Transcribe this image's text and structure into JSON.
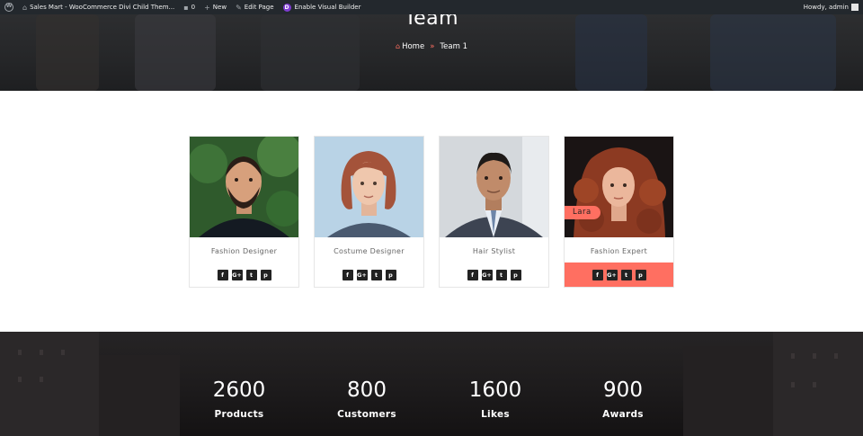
{
  "admin_bar": {
    "site_name": "Sales Mart - WooCommerce Divi Child Them...",
    "comments_count": "0",
    "new_label": "New",
    "edit_label": "Edit Page",
    "visual_builder_label": "Enable Visual Builder",
    "greeting": "Howdy, admin"
  },
  "hero": {
    "title": "Team",
    "breadcrumb_home": "Home",
    "breadcrumb_sep": "»",
    "breadcrumb_current": "Team 1"
  },
  "team": [
    {
      "role": "Fashion Designer",
      "name": "",
      "photo": "man-beard-photo"
    },
    {
      "role": "Costume Designer",
      "name": "",
      "photo": "woman-bob-photo"
    },
    {
      "role": "Hair Stylist",
      "name": "",
      "photo": "man-suit-photo"
    },
    {
      "role": "Fashion Expert",
      "name": "Lara",
      "photo": "woman-curly-photo"
    }
  ],
  "social_icons": [
    "f",
    "G+",
    "t",
    "p"
  ],
  "stats": [
    {
      "value": "2600",
      "label": "Products"
    },
    {
      "value": "800",
      "label": "Customers"
    },
    {
      "value": "1600",
      "label": "Likes"
    },
    {
      "value": "900",
      "label": "Awards"
    }
  ],
  "colors": {
    "accent": "#ff6f61",
    "admin_bar": "#23282d",
    "icon_bg": "#222222"
  }
}
